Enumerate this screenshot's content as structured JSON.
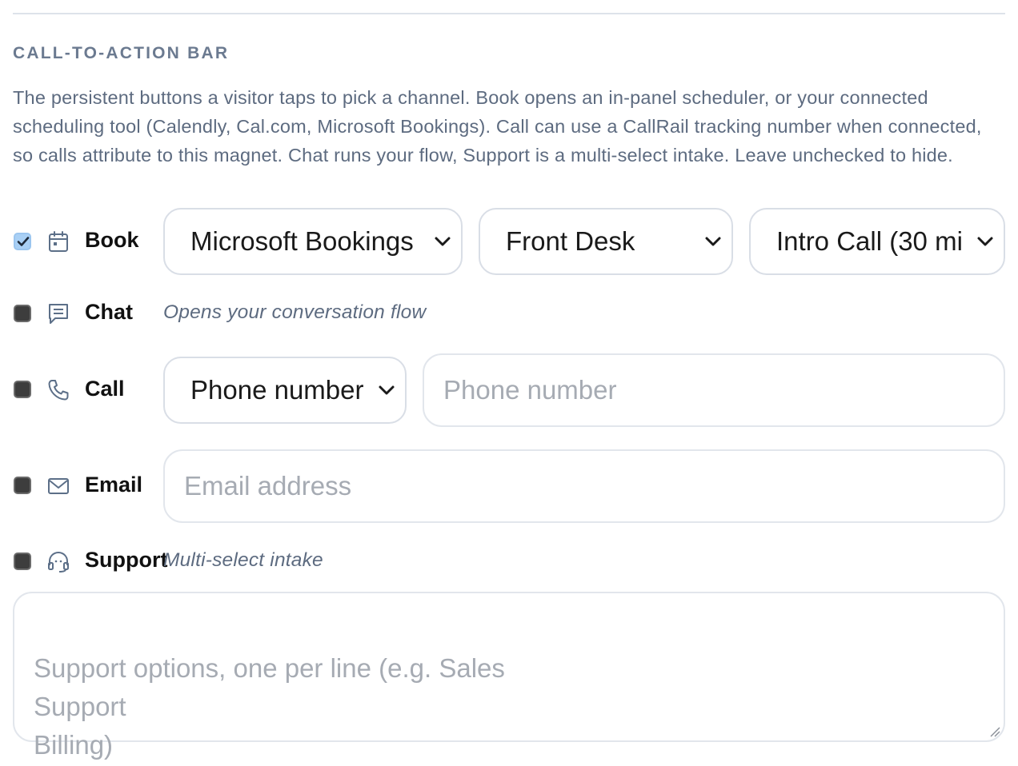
{
  "section": {
    "heading": "CALL-TO-ACTION BAR",
    "description": "The persistent buttons a visitor taps to pick a channel. Book opens an in-panel scheduler, or your connected scheduling tool (Calendly, Cal.com, Microsoft Bookings). Call can use a CallRail tracking number when connected, so calls attribute to this magnet. Chat runs your flow, Support is a multi-select intake. Leave unchecked to hide."
  },
  "rows": {
    "book": {
      "label": "Book",
      "checked": true,
      "icon": "calendar-icon",
      "provider_value": "Microsoft Bookings",
      "calendar_value": "Front Desk",
      "event_value": "Intro Call (30 mi"
    },
    "chat": {
      "label": "Chat",
      "checked": false,
      "icon": "chat-icon",
      "hint": "Opens your conversation flow"
    },
    "call": {
      "label": "Call",
      "checked": false,
      "icon": "phone-icon",
      "source_value": "Phone number",
      "number_placeholder": "Phone number"
    },
    "email": {
      "label": "Email",
      "checked": false,
      "icon": "mail-icon",
      "address_placeholder": "Email address"
    },
    "support": {
      "label": "Support",
      "checked": false,
      "icon": "headset-icon",
      "hint": "Multi-select intake",
      "options_placeholder": "Support options, one per line (e.g. Sales\nSupport\nBilling)"
    }
  },
  "colors": {
    "accent_check": "#a9d0f5",
    "muted_text": "#5d6b80",
    "heading": "#6b7a90"
  }
}
